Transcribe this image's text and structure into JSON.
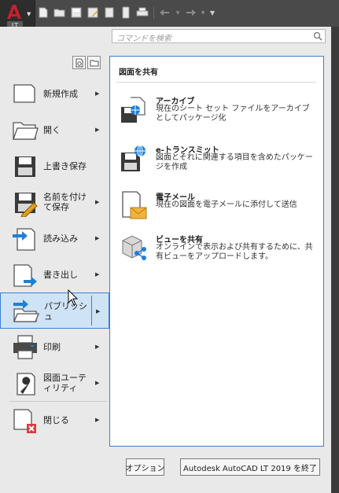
{
  "app": {
    "badge_label": "LT"
  },
  "quick_access": {
    "icons": [
      "new-icon",
      "open-icon",
      "save-icon",
      "save-as-icon",
      "publish-icon",
      "mobile-icon",
      "print-icon",
      "undo-icon",
      "redo-icon",
      "customize-icon"
    ]
  },
  "search": {
    "placeholder": "コマンドを検索"
  },
  "menu": {
    "items": [
      {
        "label": "新規作成",
        "icon": "new-document-icon",
        "has_arrow": true
      },
      {
        "label": "開く",
        "icon": "open-folder-icon",
        "has_arrow": true
      },
      {
        "label": "上書き保存",
        "icon": "save-disk-icon",
        "has_arrow": false
      },
      {
        "label": "名前を付けて保存",
        "icon": "save-as-icon",
        "has_arrow": true
      },
      {
        "label": "読み込み",
        "icon": "import-icon",
        "has_arrow": true
      },
      {
        "label": "書き出し",
        "icon": "export-icon",
        "has_arrow": true
      },
      {
        "label": "パブリッシュ",
        "icon": "publish-icon",
        "has_arrow": true
      },
      {
        "label": "印刷",
        "icon": "printer-icon",
        "has_arrow": true
      },
      {
        "label": "図面ユーティリティ",
        "icon": "wrench-icon",
        "has_arrow": true
      },
      {
        "label": "閉じる",
        "icon": "close-document-icon",
        "has_arrow": true
      }
    ]
  },
  "content": {
    "title": "図面を共有",
    "entries": [
      {
        "title": "アーカイブ",
        "description": "現在のシート セット ファイルをアーカイブとしてパッケージ化",
        "icon": "archive-icon"
      },
      {
        "title": "e-トランスミット",
        "description": "図面とそれに関連する項目を含めたパッケージを作成",
        "icon": "etransmit-icon"
      },
      {
        "title": "電子メール",
        "description": "現在の図面を電子メールに添付して送信",
        "icon": "email-icon"
      },
      {
        "title": "ビューを共有",
        "description": "オンラインで表示および共有するために、共有ビューをアップロードします。",
        "icon": "share-view-icon"
      }
    ]
  },
  "footer": {
    "options_label": "オプション",
    "exit_label": "Autodesk AutoCAD LT 2019 を終了"
  },
  "colors": {
    "accent": "#3b7fd1",
    "active_bg": "#cfe3f6",
    "app_red": "#c8202f",
    "icon_blue": "#1f7fd8"
  }
}
